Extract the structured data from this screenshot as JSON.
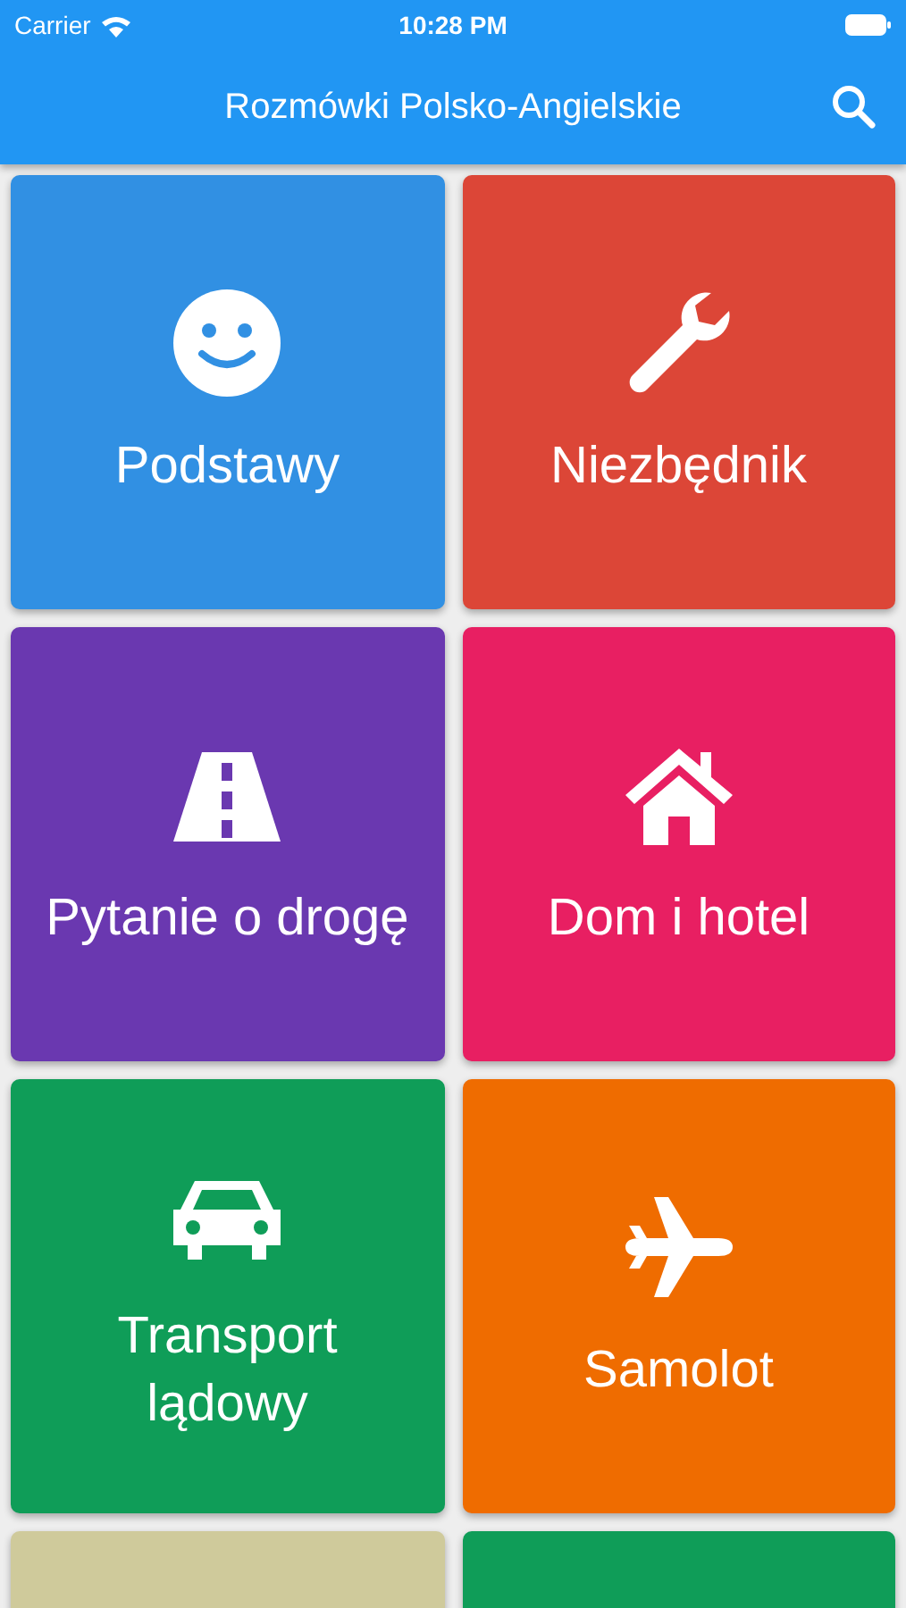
{
  "status_bar": {
    "carrier": "Carrier",
    "time": "10:28 PM"
  },
  "nav_bar": {
    "title": "Rozmówki Polsko-Angielskie"
  },
  "categories": [
    {
      "label": "Podstawy",
      "color": "#3190e3"
    },
    {
      "label": "Niezbędnik",
      "color": "#dc4637"
    },
    {
      "label": "Pytanie o drogę",
      "color": "#6a38b0"
    },
    {
      "label": "Dom i hotel",
      "color": "#e81f62"
    },
    {
      "label": "Transport lądowy",
      "color": "#0f9d58"
    },
    {
      "label": "Samolot",
      "color": "#ef6c00"
    },
    {
      "color": "#cfca9b"
    },
    {
      "color": "#0f9d58"
    }
  ]
}
